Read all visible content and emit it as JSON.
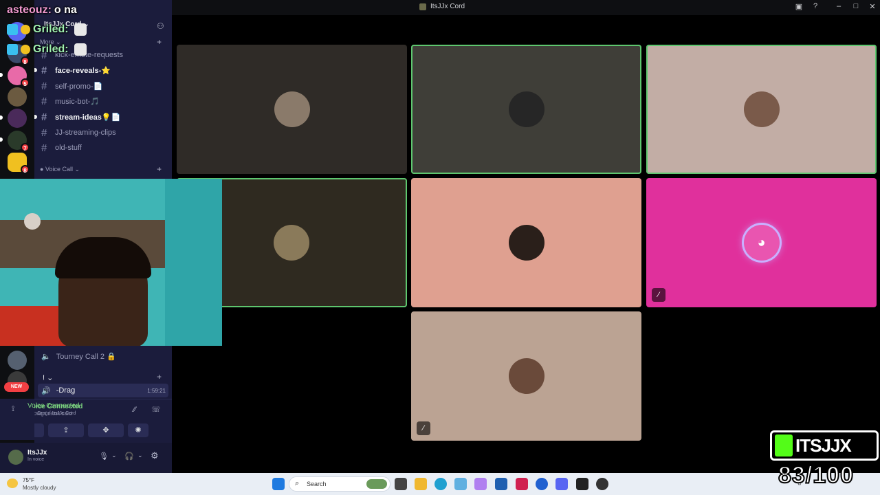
{
  "window": {
    "title": "ItsJJx Cord"
  },
  "overlay": {
    "chat": [
      {
        "user": "asteouz:",
        "message": "o na"
      },
      {
        "user": "Griled:",
        "message": ""
      },
      {
        "user": "Griled:",
        "message": ""
      }
    ],
    "watermark": "ITSJJX",
    "counter": "83/100"
  },
  "server": {
    "name": "ItsJJx Cord",
    "category_more": "More",
    "channels": [
      {
        "name": "kick-emote-requests",
        "unread": false
      },
      {
        "name": "face-reveals-⭐",
        "unread": true
      },
      {
        "name": "self-promo-📄",
        "unread": false
      },
      {
        "name": "music-bot-🎵",
        "unread": false
      },
      {
        "name": "stream-ideas💡📄",
        "unread": true
      },
      {
        "name": "JJ-streaming-clips",
        "unread": false
      },
      {
        "name": "old-stuff",
        "unread": false
      }
    ],
    "category_voice": "Voice Call",
    "voice_channel": "Tourney Call 2 🔒",
    "category_bang": "!",
    "current_voice_user": "-Drag",
    "call_timer": "1:59:21"
  },
  "server_badges": [
    "8",
    "5",
    "7",
    "8"
  ],
  "new_badge": "NEW",
  "voice_panel": {
    "status": "Voice Connected",
    "location": "-Drag / ItsJJx Cord"
  },
  "user": {
    "name": "ItsJJx",
    "status": "In voice"
  },
  "weather": {
    "temp": "75°F",
    "condition": "Mostly cloudy"
  },
  "taskbar": {
    "search_placeholder": "Search"
  },
  "colors": {
    "sidebar": "#1b1c3c",
    "speaking_ring": "#5ec76f",
    "discord_pink": "#e0309c"
  },
  "icons": [
    "windows-start-icon",
    "search-icon",
    "discord-icon",
    "mic-icon",
    "headphones-icon",
    "settings-icon",
    "mute-icon",
    "disconnect-icon"
  ]
}
